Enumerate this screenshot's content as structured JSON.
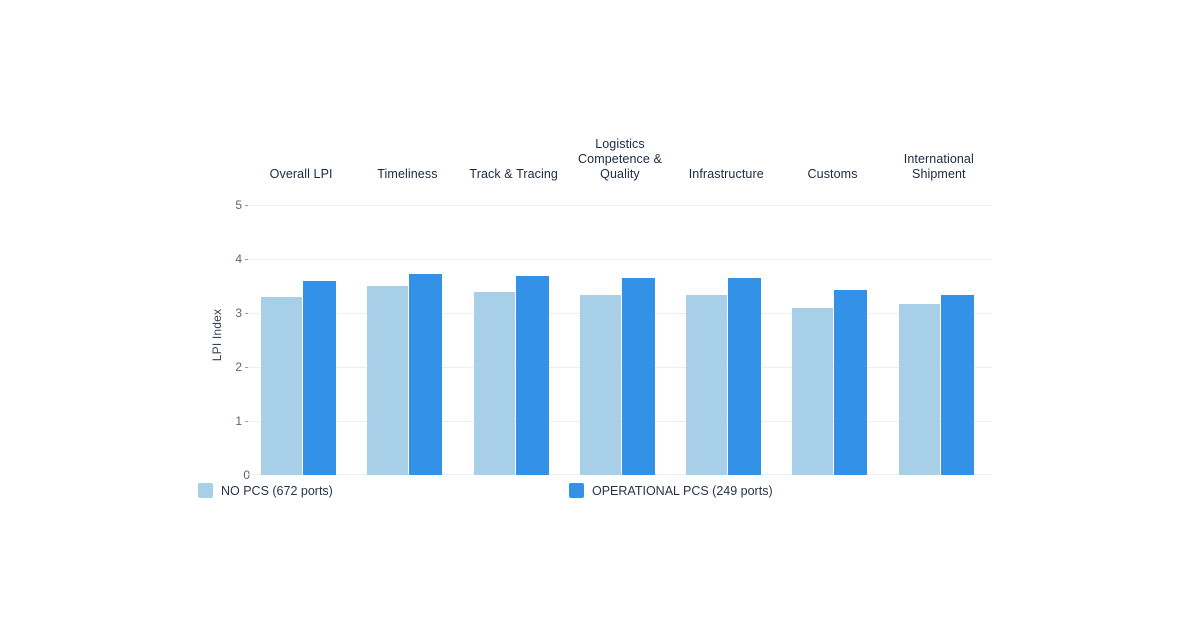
{
  "chart_data": {
    "type": "bar",
    "title": "",
    "subtitle": "",
    "xlabel": "",
    "ylabel": "LPI Index",
    "ylim": [
      0,
      5
    ],
    "yticks": [
      "0",
      "1",
      "2",
      "3",
      "4",
      "5"
    ],
    "grid": true,
    "legend_position": "bottom",
    "categories": [
      "Overall LPI",
      "Timeliness",
      "Track & Tracing",
      "Logistics Competence & Quality",
      "Infrastructure",
      "Customs",
      "International Shipment"
    ],
    "series": [
      {
        "name": "NO PCS (672 ports)",
        "color": "#a8cfe8",
        "values": [
          3.3,
          3.52,
          3.41,
          3.35,
          3.35,
          3.11,
          3.17
        ]
      },
      {
        "name": "OPERATIONAL PCS (249 ports)",
        "color": "#3392e8",
        "values": [
          3.61,
          3.74,
          3.69,
          3.67,
          3.67,
          3.43,
          3.35
        ]
      }
    ]
  },
  "axis": {
    "y_title": "LPI Index",
    "y_tick_labels": [
      "5",
      "4",
      "3",
      "2",
      "1",
      "0"
    ]
  },
  "category_labels": [
    "Overall LPI",
    "Timeliness",
    "Track & Tracing",
    "Logistics Competence & Quality",
    "Infrastructure",
    "Customs",
    "International Shipment"
  ],
  "legend": {
    "items": [
      {
        "label": "NO PCS (672 ports)",
        "color": "#a8cfe8",
        "swatch": "light-blue-square"
      },
      {
        "label": "OPERATIONAL PCS (249 ports)",
        "color": "#3392e8",
        "swatch": "blue-square"
      }
    ]
  },
  "colors": {
    "series_no_pcs": "#a8cfe8",
    "series_operational_pcs": "#3392e8",
    "gridline": "#eceef1",
    "text": "#1b2a41",
    "background": "#ffffff"
  }
}
